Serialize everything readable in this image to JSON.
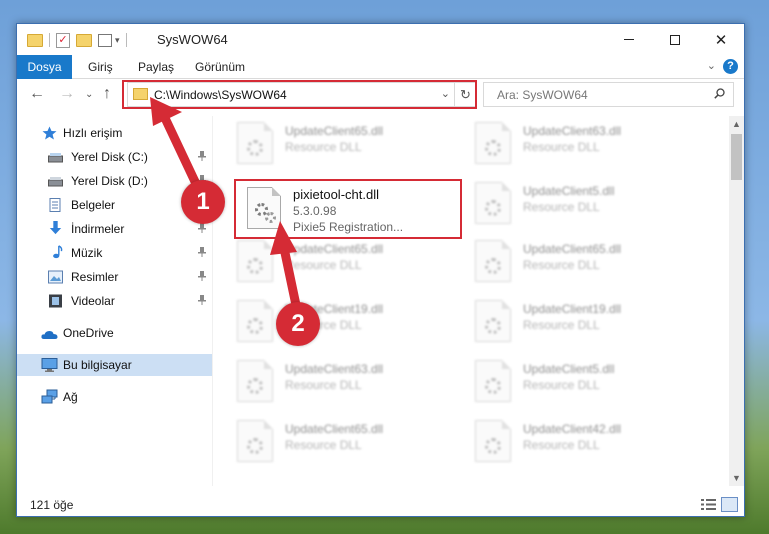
{
  "window": {
    "title": "SysWOW64",
    "controls": {
      "minimize": "—",
      "maximize": "☐",
      "close": "✕"
    }
  },
  "ribbon": {
    "tabs": [
      "Dosya",
      "Giriş",
      "Paylaş",
      "Görünüm"
    ],
    "help": "?"
  },
  "address_bar": {
    "path": "C:\\Windows\\SysWOW64",
    "search_placeholder": "Ara: SysWOW64"
  },
  "sidebar": {
    "items": [
      {
        "label": "Hızlı erişim",
        "icon": "star-icon",
        "pinned": false
      },
      {
        "label": "Yerel Disk (C:)",
        "icon": "drive-icon",
        "pinned": true
      },
      {
        "label": "Yerel Disk (D:)",
        "icon": "drive-icon",
        "pinned": true
      },
      {
        "label": "Belgeler",
        "icon": "documents-icon",
        "pinned": true
      },
      {
        "label": "İndirmeler",
        "icon": "download-icon",
        "pinned": true
      },
      {
        "label": "Müzik",
        "icon": "music-icon",
        "pinned": true
      },
      {
        "label": "Resimler",
        "icon": "pictures-icon",
        "pinned": true
      },
      {
        "label": "Videolar",
        "icon": "videos-icon",
        "pinned": true
      },
      {
        "label": "OneDrive",
        "icon": "cloud-icon",
        "pinned": false
      },
      {
        "label": "Bu bilgisayar",
        "icon": "computer-icon",
        "pinned": false,
        "selected": true
      },
      {
        "label": "Ağ",
        "icon": "network-icon",
        "pinned": false
      }
    ]
  },
  "files": {
    "left_column": [
      {
        "name": "UpdateClient65.dll",
        "type": "Resource DLL"
      },
      {
        "name": "UpdateClient65.dll",
        "type": "Resource DLL"
      },
      {
        "name": "UpdateClient19.dll",
        "type": "Resource DLL"
      },
      {
        "name": "UpdateClient63.dll",
        "type": "Resource DLL"
      },
      {
        "name": "UpdateClient65.dll",
        "type": "Resource DLL"
      }
    ],
    "right_column": [
      {
        "name": "UpdateClient63.dll",
        "type": "Resource DLL"
      },
      {
        "name": "UpdateClient5.dll",
        "type": "Resource DLL"
      },
      {
        "name": "UpdateClient65.dll",
        "type": "Resource DLL"
      },
      {
        "name": "UpdateClient19.dll",
        "type": "Resource DLL"
      },
      {
        "name": "UpdateClient5.dll",
        "type": "Resource DLL"
      },
      {
        "name": "UpdateClient42.dll",
        "type": "Resource DLL"
      }
    ],
    "highlighted": {
      "name": "pixietool-cht.dll",
      "version": "5.3.0.98",
      "description": "Pixie5 Registration..."
    }
  },
  "status": {
    "item_count": "121 öğe"
  },
  "annotations": {
    "step1": "1",
    "step2": "2",
    "color": "#d52b35"
  }
}
